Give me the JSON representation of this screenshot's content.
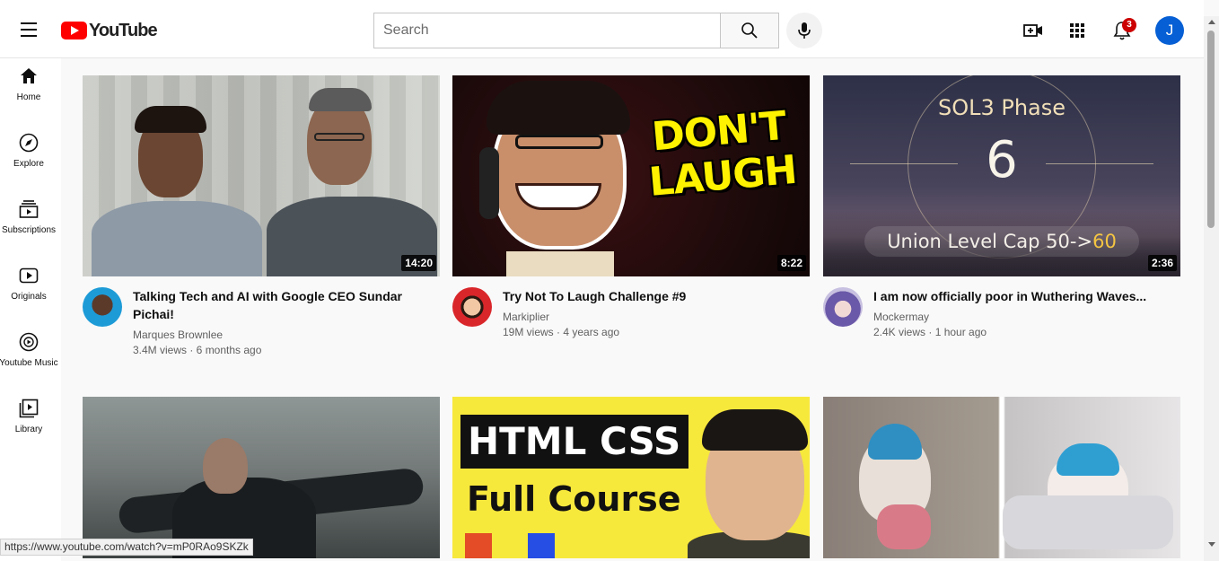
{
  "header": {
    "logo_text": "YouTube",
    "search_placeholder": "Search",
    "notification_count": "3",
    "avatar_initial": "J"
  },
  "sidebar": {
    "items": [
      {
        "label": "Home",
        "icon": "home-icon"
      },
      {
        "label": "Explore",
        "icon": "compass-icon"
      },
      {
        "label": "Subscriptions",
        "icon": "subscriptions-icon"
      },
      {
        "label": "Originals",
        "icon": "originals-icon"
      },
      {
        "label": "Youtube Music",
        "icon": "music-icon"
      },
      {
        "label": "Library",
        "icon": "library-icon"
      }
    ]
  },
  "videos": [
    {
      "title": "Talking Tech and AI with Google CEO Sundar Pichai!",
      "channel": "Marques Brownlee",
      "stats": "3.4M views · 6 months ago",
      "duration": "14:20"
    },
    {
      "title": "Try Not To Laugh Challenge #9",
      "channel": "Markiplier",
      "stats": "19M views · 4 years ago",
      "duration": "8:22",
      "thumb_text_1": "DON'T",
      "thumb_text_2": "LAUGH"
    },
    {
      "title": "I am now officially poor in Wuthering Waves...",
      "channel": "Mockermay",
      "stats": "2.4K views · 1 hour ago",
      "duration": "2:36",
      "thumb_heading": "SOL3 Phase",
      "thumb_number": "6",
      "thumb_caption": "Union Level Cap 50->",
      "thumb_caption_accent": "60"
    },
    {},
    {
      "thumb_text_1": "HTML CSS",
      "thumb_text_2": "Full Course"
    },
    {}
  ],
  "status_bar": {
    "url": "https://www.youtube.com/watch?v=mP0RAo9SKZk"
  },
  "colors": {
    "brand_red": "#ff0000",
    "badge_red": "#cc0000",
    "avatar_blue": "#065fd4",
    "secondary_text": "#606060"
  }
}
